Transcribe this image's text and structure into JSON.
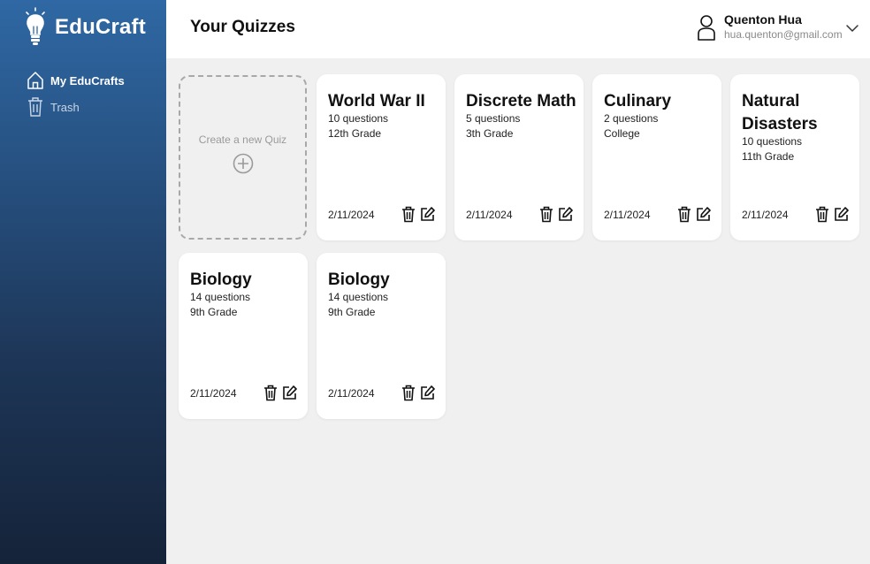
{
  "app": {
    "name": "EduCraft"
  },
  "sidebar": {
    "items": [
      {
        "label": "My EduCrafts",
        "icon": "home-icon",
        "active": true
      },
      {
        "label": "Trash",
        "icon": "trash-icon",
        "active": false
      }
    ]
  },
  "header": {
    "title": "Your Quizzes",
    "user": {
      "name": "Quenton Hua",
      "email": "hua.quenton@gmail.com"
    }
  },
  "create": {
    "label": "Create a new Quiz"
  },
  "quizzes": [
    {
      "title": "World War II",
      "questions": "10 questions",
      "grade": "12th Grade",
      "date": "2/11/2024"
    },
    {
      "title": "Discrete Math",
      "questions": "5 questions",
      "grade": "3th Grade",
      "date": "2/11/2024"
    },
    {
      "title": "Culinary",
      "questions": "2 questions",
      "grade": "College",
      "date": "2/11/2024"
    },
    {
      "title": "Natural Disasters",
      "questions": "10 questions",
      "grade": "11th Grade",
      "date": "2/11/2024"
    },
    {
      "title": "Biology",
      "questions": "14 questions",
      "grade": "9th Grade",
      "date": "2/11/2024"
    },
    {
      "title": "Biology",
      "questions": "14 questions",
      "grade": "9th Grade",
      "date": "2/11/2024"
    }
  ],
  "colors": {
    "sidebar_top": "#2f68a4",
    "sidebar_bottom": "#152339",
    "content_bg": "#f0f0f0",
    "card_bg": "#ffffff"
  }
}
